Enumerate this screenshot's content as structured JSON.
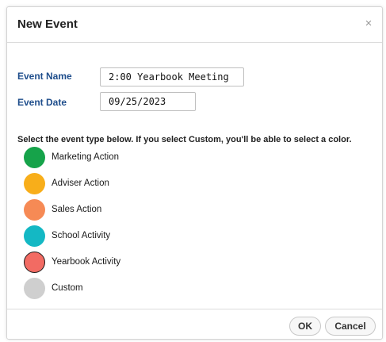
{
  "dialog": {
    "title": "New Event",
    "close_icon": "close-icon",
    "close_glyph": "×"
  },
  "form": {
    "event_name_label": "Event Name",
    "event_name_value": "2:00 Yearbook Meeting",
    "event_date_label": "Event Date",
    "event_date_value": "09/25/2023",
    "instructions": "Select the event type below. If you select Custom, you'll be able to select a color."
  },
  "event_types": [
    {
      "label": "Marketing Action",
      "color": "#16a34a",
      "selected": false
    },
    {
      "label": "Adviser Action",
      "color": "#f8ae1a",
      "selected": false
    },
    {
      "label": "Sales Action",
      "color": "#f68a55",
      "selected": false
    },
    {
      "label": "School Activity",
      "color": "#14b8c4",
      "selected": false
    },
    {
      "label": "Yearbook Activity",
      "color": "#f26b63",
      "selected": true
    },
    {
      "label": "Custom",
      "color": "#cfcfcf",
      "selected": false
    }
  ],
  "buttons": {
    "ok_label": "OK",
    "cancel_label": "Cancel"
  },
  "colors": {
    "label_blue": "#1f4e8c"
  }
}
